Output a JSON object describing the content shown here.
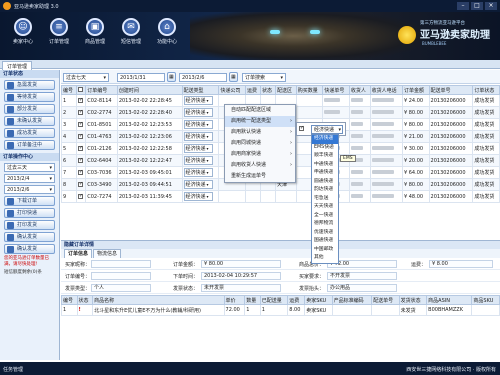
{
  "window": {
    "title": "亚马逊卖家助理 3.0",
    "controls": [
      "–",
      "□",
      "×"
    ]
  },
  "nav": [
    {
      "label": "卖家中心",
      "icon": "person-icon"
    },
    {
      "label": "订单管理",
      "icon": "document-icon"
    },
    {
      "label": "商品管理",
      "icon": "box-icon"
    },
    {
      "label": "短信管理",
      "icon": "message-icon"
    },
    {
      "label": "功能中心",
      "icon": "grid-icon"
    }
  ],
  "brand": {
    "tagline": "第三方物流亚马逊平台",
    "name": "亚马逊卖家助理",
    "en": "BUMBLEBEE"
  },
  "tab": "订单管理",
  "sidebar": {
    "section1": "订单状态",
    "status_buttons": [
      "急需发货",
      "等待发货",
      "部分发货",
      "未确认发货",
      "成功发货",
      "订单备注中"
    ],
    "section2": "订单操作中心",
    "period": "过去三天",
    "date_from": "2013/2/4",
    "date_to": "2013/2/6",
    "ops": [
      "下载订单",
      "打印快递",
      "打印发货",
      "确认发货",
      "确认发货"
    ],
    "warning": "您的亚马逊订单数量已满，请尽快处理!",
    "sms": "短信额度剩余(0)条"
  },
  "toolbar": {
    "period": "过去七天",
    "date_from": "2013/1/31",
    "date_to": "2013/2/6",
    "search": "订单搜索"
  },
  "grid": {
    "headers": [
      "编号",
      "订单编号",
      "创建时间",
      "配送类型",
      "快递公司",
      "运费",
      "状态",
      "配送区",
      "购买数量",
      "快递单号",
      "收货人",
      "收货人电话",
      "订单金额",
      "配送单号",
      "订单状态"
    ],
    "rows": [
      {
        "no": "1",
        "order": "C02-8114",
        "time": "2013-02-02 22:28:45",
        "ship": "经济快递",
        "region": "",
        "amount": "¥ 24.00",
        "track": "20130206000",
        "state": "成功发货"
      },
      {
        "no": "2",
        "order": "C02-2774",
        "time": "2013-02-02 22:28:40",
        "ship": "经济快递",
        "region": "",
        "amount": "¥ 80.00",
        "track": "20130206000",
        "state": "成功发货"
      },
      {
        "no": "3",
        "order": "C01-8501",
        "time": "2013-02-02 12:23:53",
        "ship": "经济快递",
        "region": "北京",
        "amount": "¥ 80.00",
        "track": "20130206000",
        "state": "成功发货"
      },
      {
        "no": "4",
        "order": "C01-4763",
        "time": "2013-02-02 12:23:06",
        "ship": "经济快递",
        "region": "上海",
        "amount": "¥ 21.00",
        "track": "20130206000",
        "state": "成功发货"
      },
      {
        "no": "5",
        "order": "C01-2126",
        "time": "2013-02-02 12:22:58",
        "ship": "经济快递",
        "region": "",
        "amount": "¥ 30.00",
        "track": "20130206000",
        "state": "成功发货"
      },
      {
        "no": "6",
        "order": "C02-6404",
        "time": "2013-02-02 12:22:47",
        "ship": "经济快递",
        "region": "福建",
        "amount": "¥ 20.00",
        "track": "20130206000",
        "state": "成功发货"
      },
      {
        "no": "7",
        "order": "C03-7036",
        "time": "2013-02-03 09:45:01",
        "ship": "经济快递",
        "region": "",
        "amount": "¥ 64.00",
        "track": "20130206000",
        "state": "成功发货"
      },
      {
        "no": "8",
        "order": "C03-3490",
        "time": "2013-02-03 09:44:51",
        "ship": "经济快递",
        "region": "天津",
        "amount": "¥ 80.00",
        "track": "20130206000",
        "state": "成功发货"
      },
      {
        "no": "9",
        "order": "C02-7274",
        "time": "2013-02-03 11:39:45",
        "ship": "经济快递",
        "region": "",
        "amount": "¥ 48.00",
        "track": "20130206000",
        "state": "成功发货"
      }
    ]
  },
  "context_menu": {
    "items": [
      "自动匹配配送区域",
      "启用统一配送类型",
      "启用默认快递",
      "启用同城快递",
      "启用商家快递",
      "启用收货人快递",
      "重新生成运单号"
    ],
    "highlight_index": 1
  },
  "submenu": {
    "value": "经济快递"
  },
  "dropdown": {
    "options": [
      "经济快递",
      "EMS快递",
      "顺丰快递",
      "中通快递",
      "申通快递",
      "圆通快递",
      "韵达快递",
      "宅急送",
      "天天快递",
      "全一快递",
      "德邦物流",
      "优速快递",
      "国通快递",
      "中国邮政",
      "其他"
    ],
    "selected_index": 0
  },
  "tooltip": "EMS",
  "detail": {
    "title": "隐藏订单详情",
    "tabs": [
      "订单信息",
      "物流信息"
    ],
    "fields": {
      "buyer_label": "买家昵称：",
      "buyer_value": "",
      "order_amount_label": "订单金额：",
      "order_amount": "¥ 80.00",
      "goods_total_label": "商品总价：",
      "goods_total": "¥ 72.00",
      "freight_label": "运费：",
      "freight": "¥ 8.00",
      "order_no_label": "订单编号：",
      "order_no": "",
      "order_time_label": "下单时间：",
      "order_time": "2013-02-04 10:29:57",
      "buyer_req_label": "买家要求：",
      "buyer_req": "不开发票",
      "invoice_type_label": "发票类型：",
      "invoice_type": "个人",
      "invoice_status_label": "发票状态：",
      "invoice_status": "未开发票",
      "invoice_title_label": "发票抬头：",
      "invoice_title": "办公用品"
    },
    "items_headers": [
      "编号",
      "状态",
      "商品名称",
      "单价",
      "数量",
      "已配送量",
      "运费",
      "卖家SKU",
      "产品标准编码",
      "配送单号",
      "发货状态",
      "商品ASIN",
      "商品SKU"
    ],
    "items": [
      {
        "no": "1",
        "state": "!",
        "name": "北斗星和东升E优儿童E不万为什么(教辅/科研用)",
        "price": "72.00",
        "qty": "1",
        "shipped": "1",
        "freight": "8.00",
        "sku": "卖家SKU",
        "code": "",
        "track": "",
        "ship_state": "未发货",
        "asin": "B00BHAMZZK",
        "psku": ""
      }
    ]
  },
  "statusbar": {
    "left": "任务管理",
    "right": "西安世三捷网络科技有限公司 · 版权所有"
  }
}
